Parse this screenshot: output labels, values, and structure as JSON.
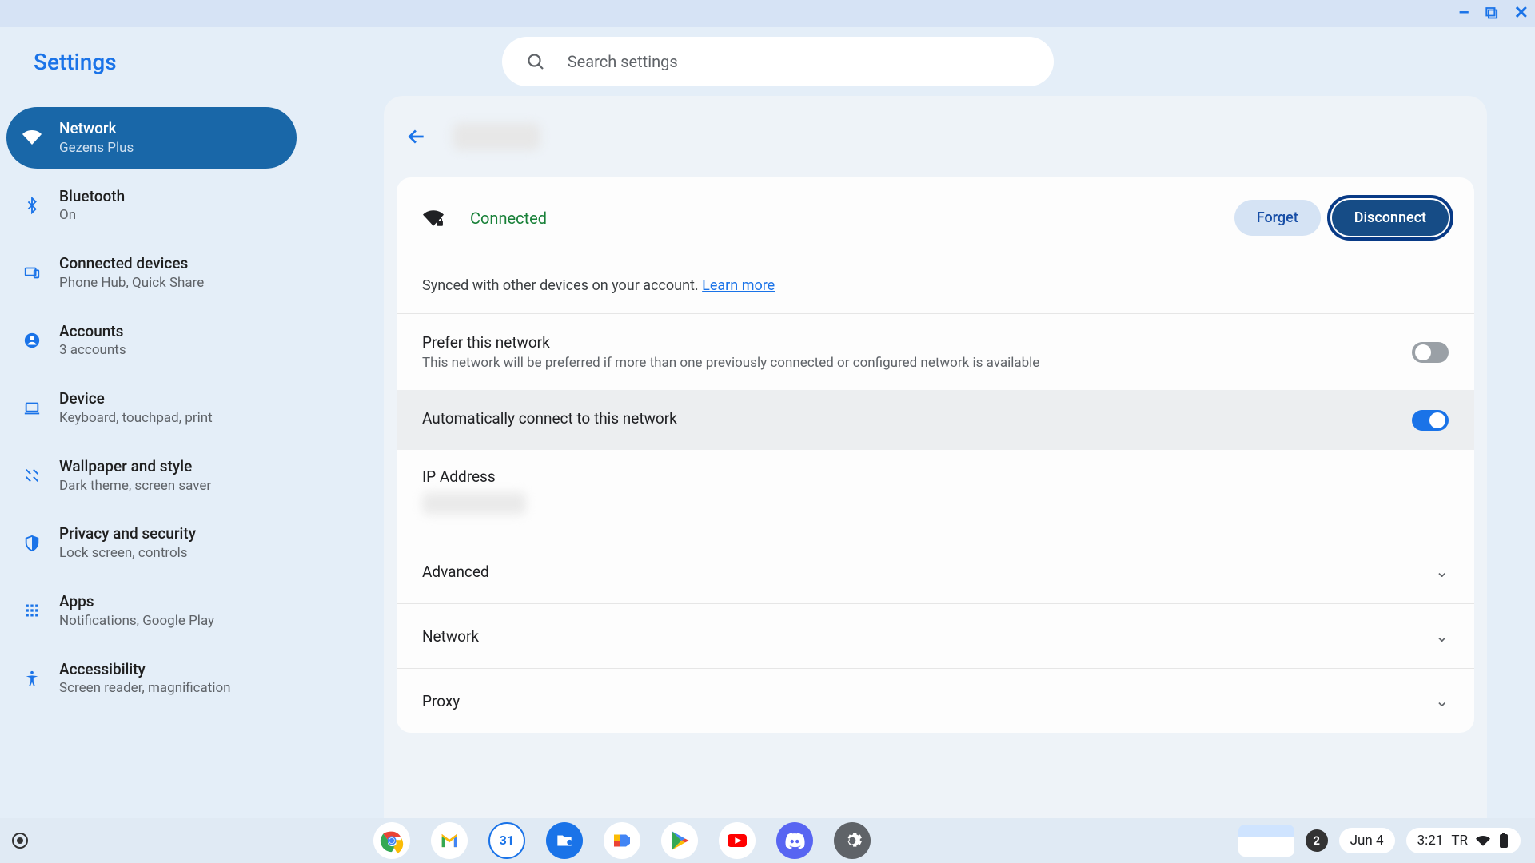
{
  "header": {
    "title": "Settings"
  },
  "search": {
    "placeholder": "Search settings"
  },
  "sidebar": {
    "items": [
      {
        "label": "Network",
        "sub": "Gezens Plus"
      },
      {
        "label": "Bluetooth",
        "sub": "On"
      },
      {
        "label": "Connected devices",
        "sub": "Phone Hub, Quick Share"
      },
      {
        "label": "Accounts",
        "sub": "3 accounts"
      },
      {
        "label": "Device",
        "sub": "Keyboard, touchpad, print"
      },
      {
        "label": "Wallpaper and style",
        "sub": "Dark theme, screen saver"
      },
      {
        "label": "Privacy and security",
        "sub": "Lock screen, controls"
      },
      {
        "label": "Apps",
        "sub": "Notifications, Google Play"
      },
      {
        "label": "Accessibility",
        "sub": "Screen reader, magnification"
      }
    ]
  },
  "detail": {
    "status": "Connected",
    "forget_btn": "Forget",
    "disconnect_btn": "Disconnect",
    "sync_text": "Synced with other devices on your account. ",
    "learn_more": "Learn more",
    "prefer_title": "Prefer this network",
    "prefer_sub": "This network will be preferred if more than one previously connected or configured network is available",
    "prefer_on": false,
    "auto_title": "Automatically connect to this network",
    "auto_on": true,
    "ip_label": "IP Address",
    "sections": [
      {
        "label": "Advanced"
      },
      {
        "label": "Network"
      },
      {
        "label": "Proxy"
      }
    ]
  },
  "shelf": {
    "notif_count": "2",
    "date": "Jun 4",
    "time": "3:21",
    "locale": "TR"
  }
}
